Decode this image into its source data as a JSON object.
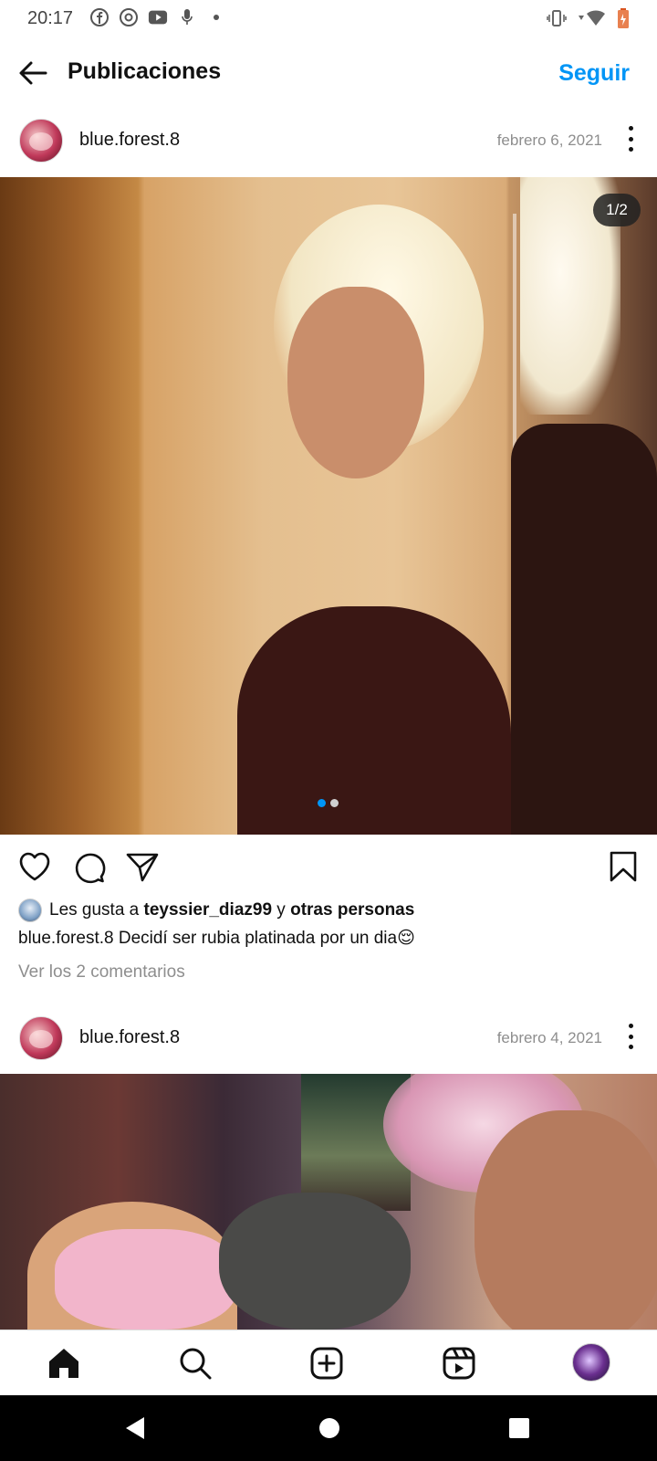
{
  "status_bar": {
    "time": "20:17",
    "left_icons": [
      "facebook-icon",
      "chrome-icon",
      "youtube-icon",
      "mic-icon",
      "dot-icon"
    ],
    "right_icons": [
      "vibrate-icon",
      "wifi-icon",
      "battery-icon"
    ]
  },
  "header": {
    "title": "Publicaciones",
    "follow_label": "Seguir",
    "accent_color": "#0095f6"
  },
  "posts": [
    {
      "username": "blue.forest.8",
      "date": "febrero 6, 2021",
      "counter": "1/2",
      "carousel_total": 2,
      "carousel_active": 1,
      "likes_prefix": "Les gusta a ",
      "liked_by": "teyssier_diaz99",
      "likes_mid": " y ",
      "likes_others": "otras personas",
      "caption_user": "blue.forest.8",
      "caption_text": " Decidí ser rubia platinada por un dia😌",
      "comments_link": "Ver los 2 comentarios"
    },
    {
      "username": "blue.forest.8",
      "date": "febrero 4, 2021"
    }
  ],
  "bottom_nav": [
    "home-icon",
    "search-icon",
    "new-post-icon",
    "reels-icon",
    "profile-avatar"
  ]
}
